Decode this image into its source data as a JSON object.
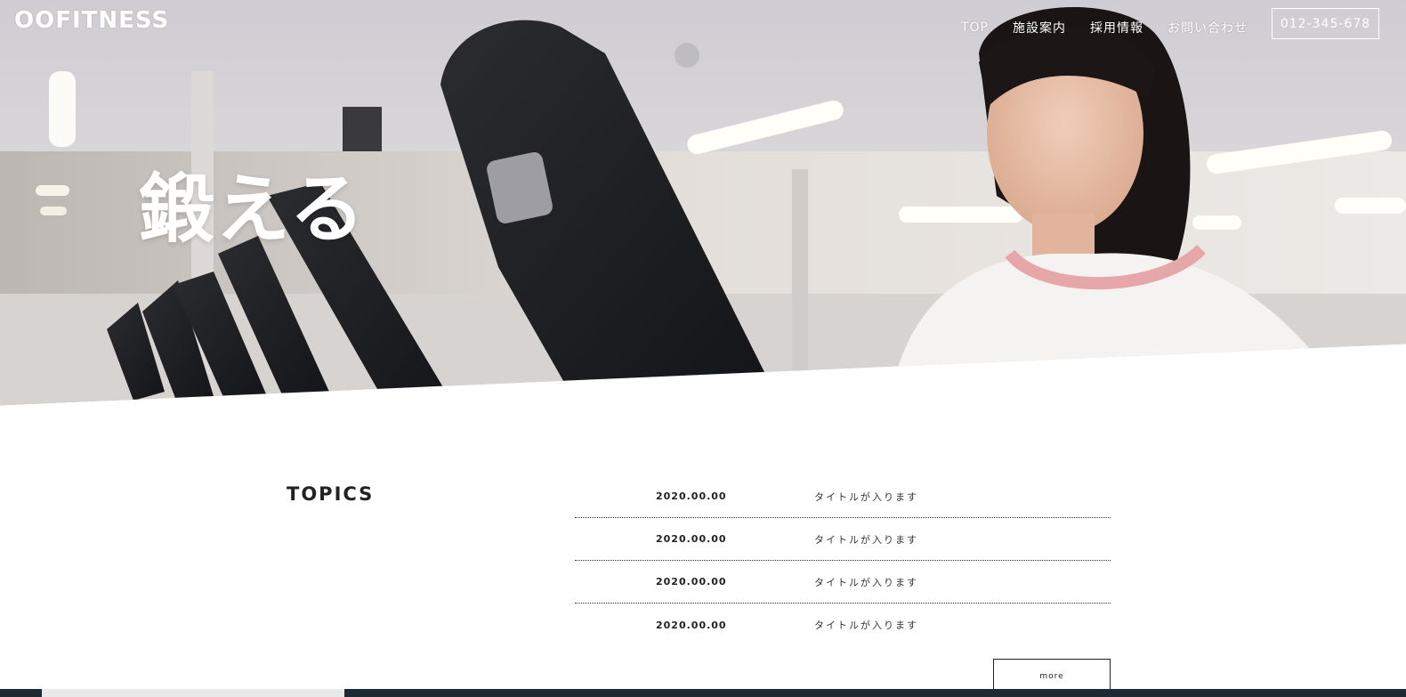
{
  "header": {
    "logo": "OOFITNESS",
    "nav": [
      "TOP",
      "施設案内",
      "採用情報",
      "お問い合わせ"
    ],
    "tel": "012-345-678"
  },
  "hero": {
    "copy": "鍛える"
  },
  "topics": {
    "title": "TOPICS",
    "items": [
      {
        "date": "2020.00.00",
        "title": "タイトルが入ります"
      },
      {
        "date": "2020.00.00",
        "title": "タイトルが入ります"
      },
      {
        "date": "2020.00.00",
        "title": "タイトルが入ります"
      },
      {
        "date": "2020.00.00",
        "title": "タイトルが入ります"
      }
    ],
    "more_label": "more"
  },
  "colors": {
    "text": "#222222",
    "hero_overlay_text": "#ffffff",
    "footer_strip": "#1d2a33"
  }
}
